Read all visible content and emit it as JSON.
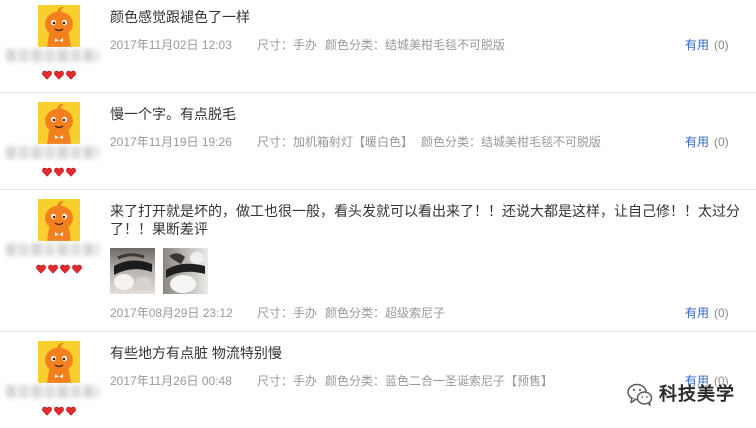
{
  "labels": {
    "size": "尺寸：",
    "color": "颜色分类：",
    "useful": "有用"
  },
  "reviews": [
    {
      "text": "颜色感觉跟褪色了一样",
      "date": "2017年11月02日 12:03",
      "size": "手办",
      "color": "结城美柑毛毯不可脱版",
      "useful_count": "(0)",
      "rank_hearts": 3,
      "photo_count": 0
    },
    {
      "text": "慢一个字。有点脱毛",
      "date": "2017年11月19日 19:26",
      "size": "加机箱射灯【暖白色】",
      "color": "结城美柑毛毯不可脱版",
      "useful_count": "(0)",
      "rank_hearts": 3,
      "photo_count": 0
    },
    {
      "text": "来了打开就是坏的，做工也很一般，看头发就可以看出来了！！还说大都是这样，让自己修！！太过分了！！果断差评",
      "date": "2017年08月29日 23:12",
      "size": "手办",
      "color": "超级索尼子",
      "useful_count": "(0)",
      "rank_hearts": 4,
      "photo_count": 2
    },
    {
      "text": "有些地方有点脏 物流特别慢",
      "date": "2017年11月26日 00:48",
      "size": "手办",
      "color": "蓝色二合一圣诞索尼子【预售】",
      "useful_count": "(0)",
      "rank_hearts": 3,
      "photo_count": 0
    }
  ],
  "watermark": {
    "icon": "wechat-icon",
    "text": "科技美学"
  },
  "theme": {
    "text_color": "#333333",
    "meta_color": "#999999",
    "link_color": "#3366cc",
    "heart_color": "#e52b2f",
    "divider_color": "#e6e6e6",
    "avatar_bg": "#f9cf2e",
    "avatar_mascot": "#f2801e"
  }
}
